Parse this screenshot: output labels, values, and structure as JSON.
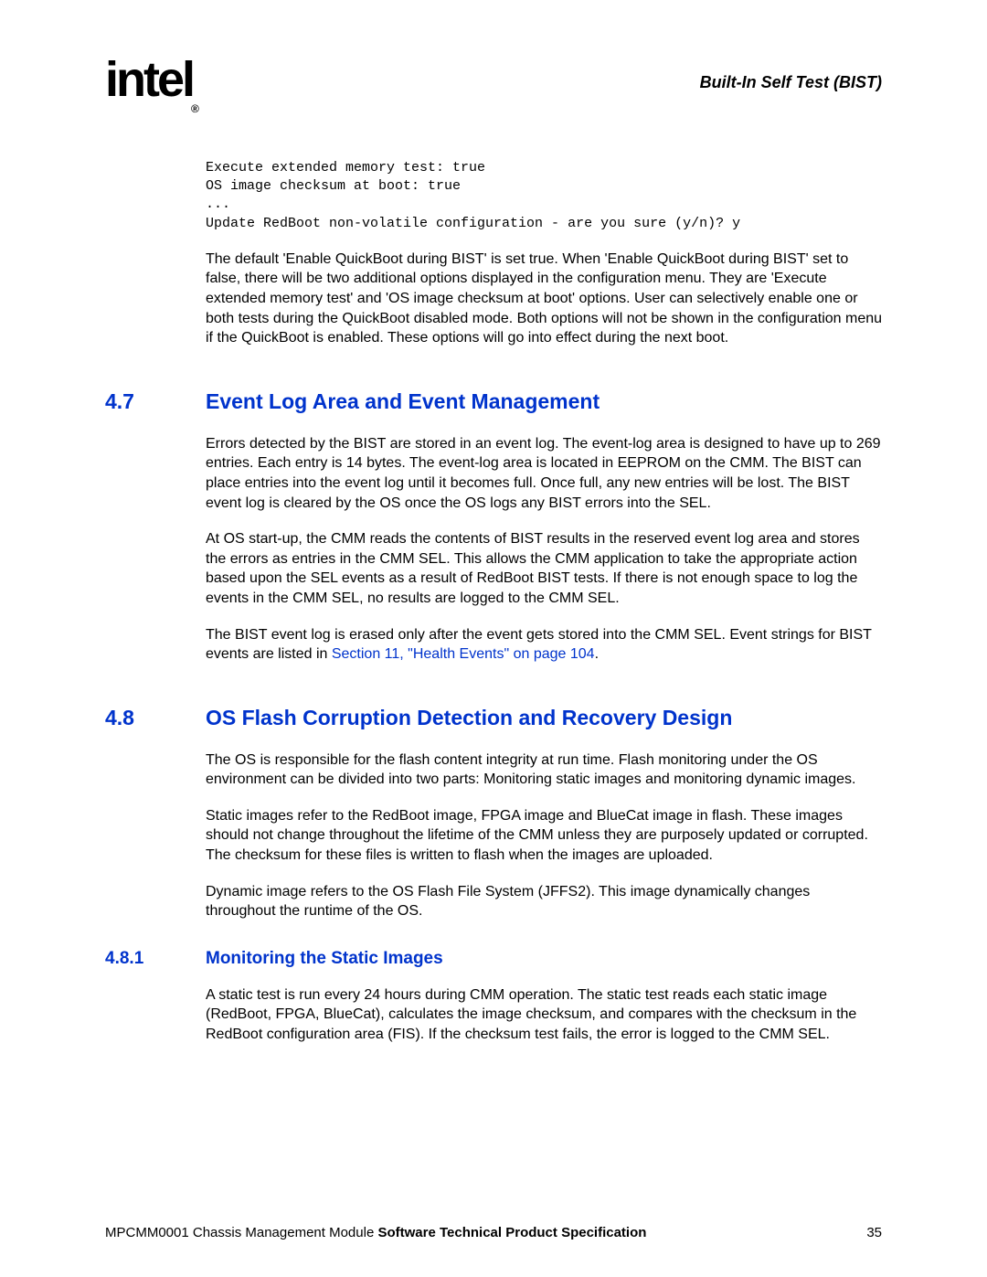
{
  "header": {
    "logo_main": "intel",
    "logo_sub": "®",
    "title": "Built-In Self Test (BIST)"
  },
  "code": "Execute extended memory test: true\nOS image checksum at boot: true\n...\nUpdate RedBoot non-volatile configuration - are you sure (y/n)? y",
  "para1": "The default 'Enable QuickBoot during BIST' is set true. When 'Enable QuickBoot during BIST' set to false, there will be two additional options displayed in the configuration menu. They are 'Execute extended memory test' and 'OS image checksum at boot' options. User can selectively enable one or both tests during the QuickBoot disabled mode. Both options will not be shown in the configuration menu if the QuickBoot is enabled. These options will go into effect during the next boot.",
  "sec47": {
    "num": "4.7",
    "title": "Event Log Area and Event Management",
    "p1": "Errors detected by the BIST are stored in an event log. The event-log area is designed to have up to 269 entries. Each entry is 14 bytes. The event-log area is located in EEPROM on the CMM. The BIST can place entries into the event log until it becomes full. Once full, any new entries will be lost. The BIST event log is cleared by the OS once the OS logs any BIST errors into the SEL.",
    "p2": "At OS start-up, the CMM reads the contents of BIST results in the reserved event log area and stores the errors as entries in the CMM SEL. This allows the CMM application to take the appropriate action based upon the SEL events as a result of RedBoot BIST tests. If there is not enough space to log the events in the CMM SEL, no results are logged to the CMM SEL.",
    "p3a": "The BIST event log is erased only after the event gets stored into the CMM SEL. Event strings for BIST events are listed in ",
    "p3link": "Section 11, \"Health Events\" on page 104",
    "p3b": "."
  },
  "sec48": {
    "num": "4.8",
    "title": "OS Flash Corruption Detection and Recovery Design",
    "p1": "The OS is responsible for the flash content integrity at run time. Flash monitoring under the OS environment can be divided into two parts: Monitoring static images and monitoring dynamic images.",
    "p2": "Static images refer to the RedBoot image, FPGA image and BlueCat image in flash. These images should not change throughout the lifetime of the CMM unless they are purposely updated or corrupted. The checksum for these files is written to flash when the images are uploaded.",
    "p3": "Dynamic image refers to the OS Flash File System (JFFS2). This image dynamically changes throughout the runtime of the OS."
  },
  "sec481": {
    "num": "4.8.1",
    "title": "Monitoring the Static Images",
    "p1": "A static test is run every 24 hours during CMM operation. The static test reads each static image (RedBoot, FPGA, BlueCat), calculates the image checksum, and compares with the checksum in the RedBoot configuration area (FIS). If the checksum test fails, the error is logged to the CMM SEL."
  },
  "footer": {
    "left_plain": "MPCMM0001 Chassis Management Module ",
    "left_bold": "Software Technical Product Specification",
    "page": "35"
  }
}
